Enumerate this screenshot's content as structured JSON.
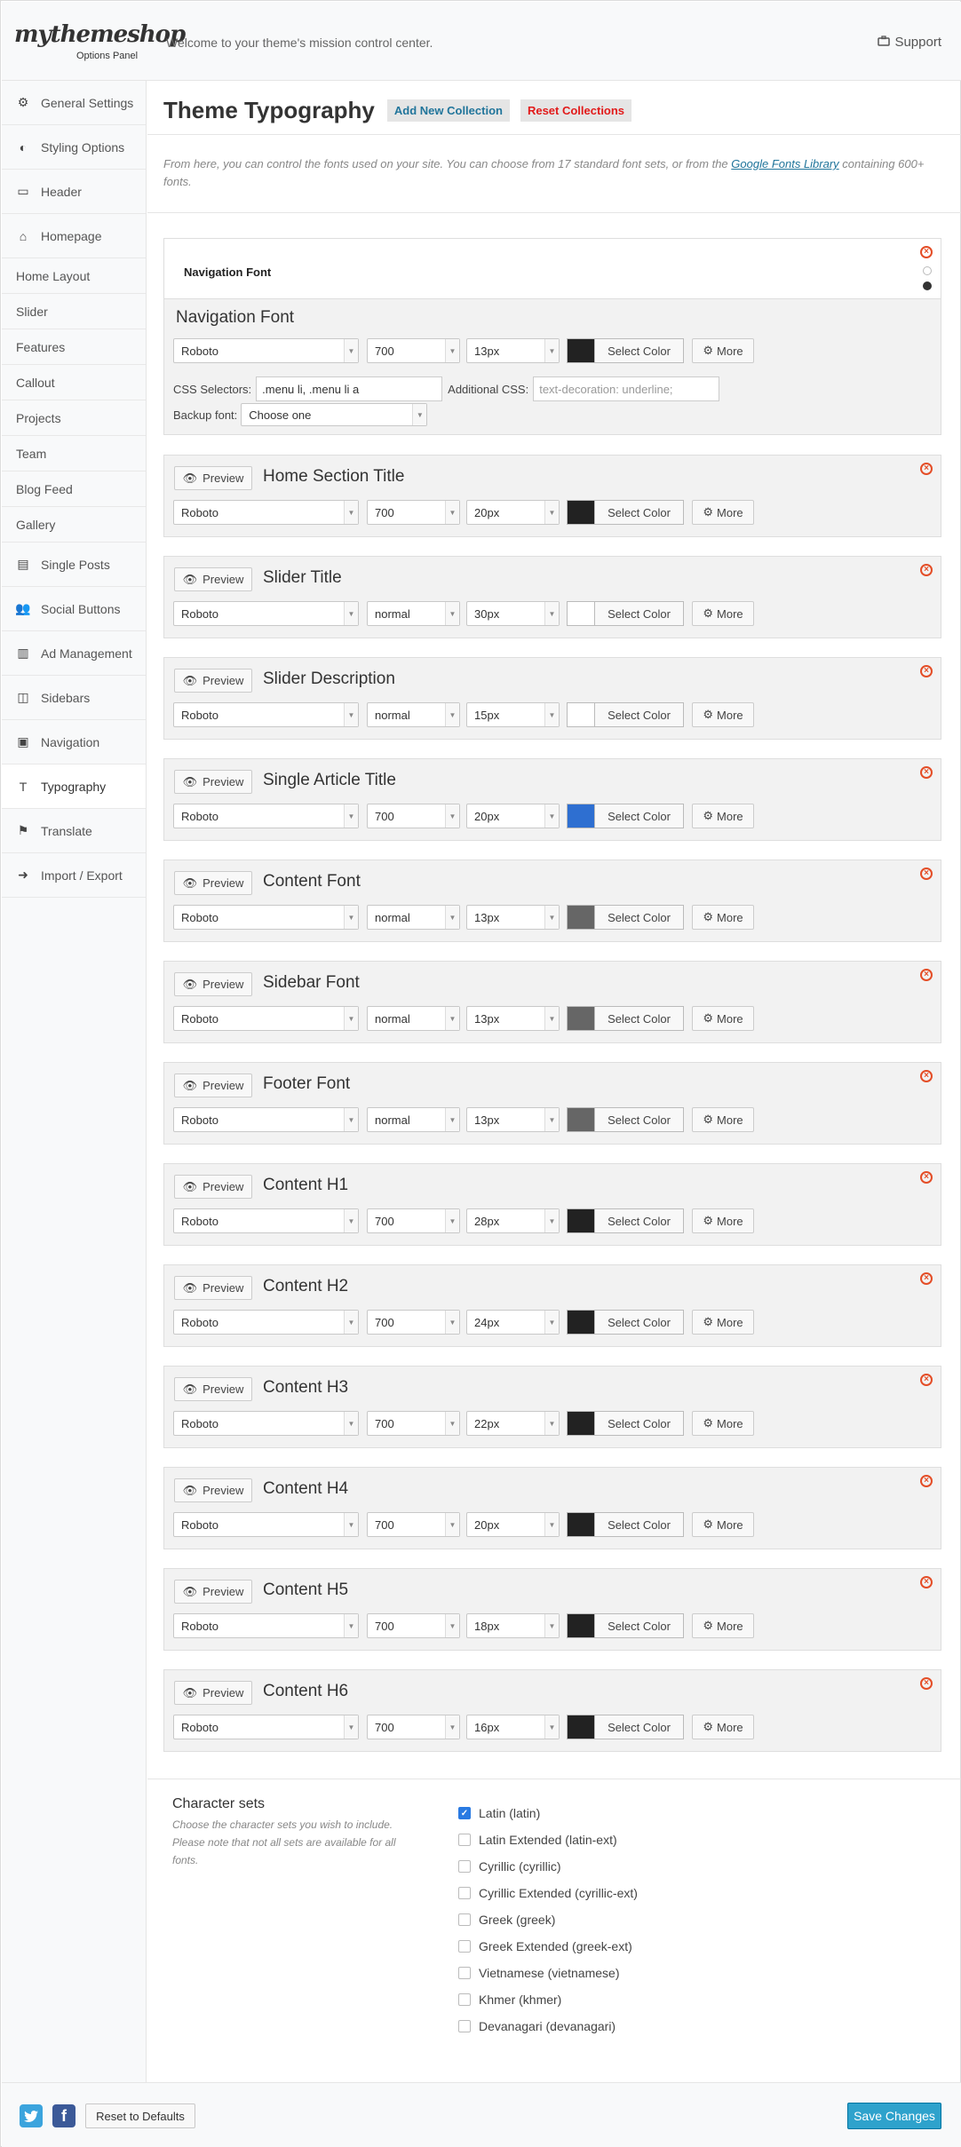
{
  "header": {
    "logo": "mythemeshop",
    "logo_sub": "Options Panel",
    "welcome": "Welcome to your theme's mission control center.",
    "support_label": "Support"
  },
  "sidebar": {
    "items": [
      {
        "label": "General Settings",
        "icon": "gears-icon"
      },
      {
        "label": "Styling Options",
        "icon": "contrast-icon"
      },
      {
        "label": "Header",
        "icon": "card-icon"
      },
      {
        "label": "Homepage",
        "icon": "home-icon"
      },
      {
        "label": "Home Layout",
        "sub": true
      },
      {
        "label": "Slider",
        "sub": true
      },
      {
        "label": "Features",
        "sub": true
      },
      {
        "label": "Callout",
        "sub": true
      },
      {
        "label": "Projects",
        "sub": true
      },
      {
        "label": "Team",
        "sub": true
      },
      {
        "label": "Blog Feed",
        "sub": true
      },
      {
        "label": "Gallery",
        "sub": true
      },
      {
        "label": "Single Posts",
        "icon": "file-icon"
      },
      {
        "label": "Social Buttons",
        "icon": "users-icon"
      },
      {
        "label": "Ad Management",
        "icon": "chart-icon"
      },
      {
        "label": "Sidebars",
        "icon": "columns-icon"
      },
      {
        "label": "Navigation",
        "icon": "browser-icon"
      },
      {
        "label": "Typography",
        "icon": "text-icon",
        "active": true
      },
      {
        "label": "Translate",
        "icon": "flag-icon"
      },
      {
        "label": "Import / Export",
        "icon": "sign-in-icon"
      }
    ]
  },
  "main": {
    "title": "Theme Typography",
    "add_collection": "Add New Collection",
    "reset_collections": "Reset Collections",
    "intro_before": "From here, you can control the fonts used on your site. You can choose from 17 standard font sets, or from the ",
    "intro_link": "Google Fonts Library",
    "intro_after": " containing 600+ fonts."
  },
  "nav_font": {
    "preview_text": "Navigation Font",
    "title": "Navigation Font",
    "font": "Roboto",
    "weight": "700",
    "size": "13px",
    "color": "#222222",
    "css_selectors_label": "CSS Selectors:",
    "css_selectors_value": ".menu li, .menu li a",
    "additional_css_label": "Additional CSS:",
    "additional_css_placeholder": "text-decoration: underline;",
    "backup_font_label": "Backup font:",
    "backup_font_value": "Choose one"
  },
  "labels": {
    "preview": "Preview",
    "select_color": "Select Color",
    "more": "More"
  },
  "fonts": [
    {
      "title": "Home Section Title",
      "font": "Roboto",
      "weight": "700",
      "size": "20px",
      "color": "#222222"
    },
    {
      "title": "Slider Title",
      "font": "Roboto",
      "weight": "normal",
      "size": "30px",
      "color": "#ffffff"
    },
    {
      "title": "Slider Description",
      "font": "Roboto",
      "weight": "normal",
      "size": "15px",
      "color": "#ffffff"
    },
    {
      "title": "Single Article Title",
      "font": "Roboto",
      "weight": "700",
      "size": "20px",
      "color": "#2e6fd1"
    },
    {
      "title": "Content Font",
      "font": "Roboto",
      "weight": "normal",
      "size": "13px",
      "color": "#666666"
    },
    {
      "title": "Sidebar Font",
      "font": "Roboto",
      "weight": "normal",
      "size": "13px",
      "color": "#666666"
    },
    {
      "title": "Footer Font",
      "font": "Roboto",
      "weight": "normal",
      "size": "13px",
      "color": "#666666"
    },
    {
      "title": "Content H1",
      "font": "Roboto",
      "weight": "700",
      "size": "28px",
      "color": "#222222"
    },
    {
      "title": "Content H2",
      "font": "Roboto",
      "weight": "700",
      "size": "24px",
      "color": "#222222"
    },
    {
      "title": "Content H3",
      "font": "Roboto",
      "weight": "700",
      "size": "22px",
      "color": "#222222"
    },
    {
      "title": "Content H4",
      "font": "Roboto",
      "weight": "700",
      "size": "20px",
      "color": "#222222"
    },
    {
      "title": "Content H5",
      "font": "Roboto",
      "weight": "700",
      "size": "18px",
      "color": "#222222"
    },
    {
      "title": "Content H6",
      "font": "Roboto",
      "weight": "700",
      "size": "16px",
      "color": "#222222"
    }
  ],
  "charsets": {
    "title": "Character sets",
    "description": "Choose the character sets you wish to include. Please note that not all sets are available for all fonts.",
    "items": [
      {
        "label": "Latin (latin)",
        "checked": true
      },
      {
        "label": "Latin Extended (latin-ext)",
        "checked": false
      },
      {
        "label": "Cyrillic (cyrillic)",
        "checked": false
      },
      {
        "label": "Cyrillic Extended (cyrillic-ext)",
        "checked": false
      },
      {
        "label": "Greek (greek)",
        "checked": false
      },
      {
        "label": "Greek Extended (greek-ext)",
        "checked": false
      },
      {
        "label": "Vietnamese (vietnamese)",
        "checked": false
      },
      {
        "label": "Khmer (khmer)",
        "checked": false
      },
      {
        "label": "Devanagari (devanagari)",
        "checked": false
      }
    ]
  },
  "footer": {
    "reset_label": "Reset to Defaults",
    "save_label": "Save Changes"
  }
}
